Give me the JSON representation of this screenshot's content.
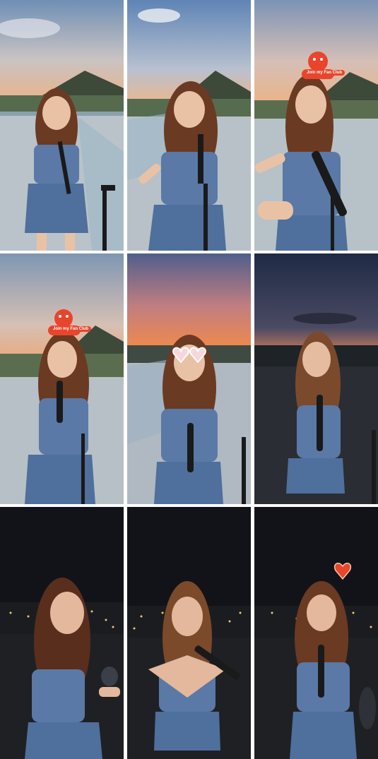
{
  "stickers": {
    "fan_club_text": "Join my Fan Club"
  },
  "palette": {
    "dusk_sky_top": "#6f8fb5",
    "dusk_sky_bottom": "#e8b48e",
    "sunset_orange": "#f08a4b",
    "night_sky": "#141620",
    "dress_blue": "#5a79a6",
    "hair_brown": "#6b3a22",
    "skin": "#e9c2a6",
    "sticker_red": "#e8452c"
  },
  "tiles": [
    {
      "scene": "dusk-rooftop",
      "sticker": "none"
    },
    {
      "scene": "dusk-rooftop",
      "sticker": "none"
    },
    {
      "scene": "dusk-rooftop",
      "sticker": "fan-club"
    },
    {
      "scene": "dusk-rooftop",
      "sticker": "fan-club"
    },
    {
      "scene": "sunset-rooftop",
      "sticker": "heart-glasses"
    },
    {
      "scene": "twilight-rooftop",
      "sticker": "none"
    },
    {
      "scene": "night-rooftop",
      "sticker": "none"
    },
    {
      "scene": "night-rooftop",
      "sticker": "none"
    },
    {
      "scene": "night-rooftop",
      "sticker": "heart"
    }
  ]
}
